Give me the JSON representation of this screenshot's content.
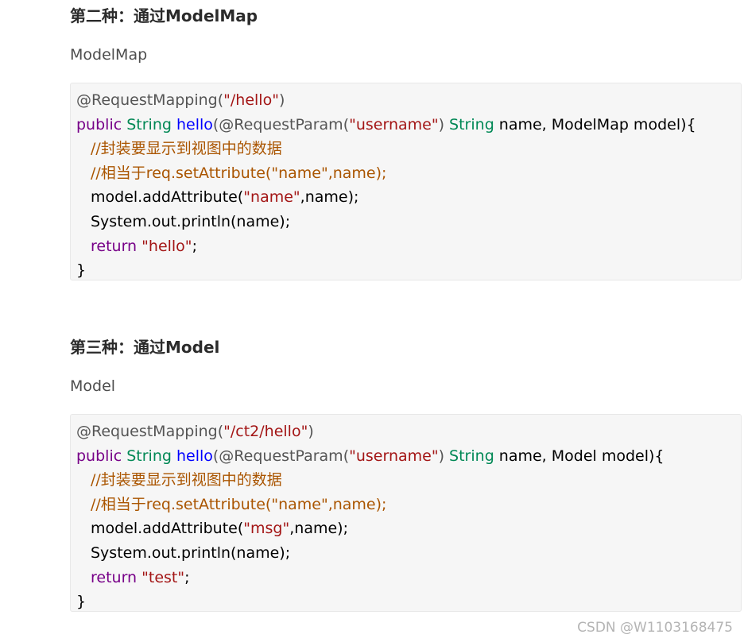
{
  "section1": {
    "heading": "第二种：通过ModelMap",
    "paragraph": "ModelMap",
    "code": {
      "l1": {
        "anno": "@RequestMapping(",
        "str": "\"/hello\"",
        "close": ")"
      },
      "l2": {
        "kw": "public",
        "type1": "String",
        "fn": "hello",
        "p1": "(@RequestParam(",
        "str": "\"username\"",
        "p2": ") ",
        "type2": "String",
        "rest": " name, ModelMap model){"
      },
      "l3": {
        "comment": "//封装要显示到视图中的数据"
      },
      "l4": {
        "comment": "//相当于req.setAttribute(\"name\",name);"
      },
      "l5": {
        "pre": "model.addAttribute(",
        "str": "\"name\"",
        "post": ",name);"
      },
      "l6": {
        "text": "System.out.println(name);"
      },
      "l7": {
        "kw": "return",
        "str": "\"hello\"",
        "post": ";"
      },
      "l8": {
        "text": "}"
      }
    }
  },
  "section2": {
    "heading": "第三种：通过Model",
    "paragraph": "Model",
    "code": {
      "l1": {
        "anno": "@RequestMapping(",
        "str": "\"/ct2/hello\"",
        "close": ")"
      },
      "l2": {
        "kw": "public",
        "type1": "String",
        "fn": "hello",
        "p1": "(@RequestParam(",
        "str": "\"username\"",
        "p2": ") ",
        "type2": "String",
        "rest": " name, Model model){"
      },
      "l3": {
        "comment": "//封装要显示到视图中的数据"
      },
      "l4": {
        "comment": "//相当于req.setAttribute(\"name\",name);"
      },
      "l5": {
        "pre": "model.addAttribute(",
        "str": "\"msg\"",
        "post": ",name);"
      },
      "l6": {
        "text": "System.out.println(name);"
      },
      "l7": {
        "kw": "return",
        "str": "\"test\"",
        "post": ";"
      },
      "l8": {
        "text": "}"
      }
    }
  },
  "watermark": "CSDN @W1103168475",
  "colors": {
    "annotation": "#555555",
    "string": "#a31515",
    "keyword": "#770088",
    "type": "#008855",
    "function": "#0000ff",
    "comment": "#aa5500",
    "code_background": "#f6f6f6"
  }
}
